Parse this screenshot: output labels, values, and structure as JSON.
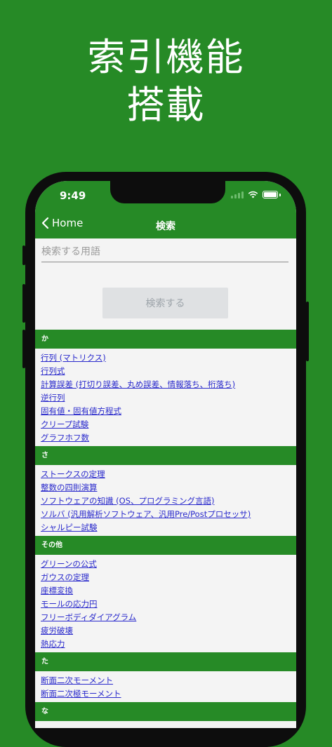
{
  "promo": {
    "line1": "索引機能",
    "line2": "搭載"
  },
  "status_bar": {
    "time": "9:49"
  },
  "nav": {
    "back_label": "Home",
    "title": "検索"
  },
  "search": {
    "placeholder": "検索する用語",
    "value": "",
    "button_label": "検索する"
  },
  "sections": [
    {
      "header": "か",
      "items": [
        "行列 (マトリクス)",
        "行列式",
        "計算誤差 (打切り誤差、丸め誤差、情報落ち、桁落ち)",
        "逆行列",
        "固有値・固有値方程式",
        " クリープ試験",
        "グラフホフ数"
      ]
    },
    {
      "header": "さ",
      "items": [
        "ストークスの定理",
        "整数の四則演算",
        "ソフトウェアの知識 (OS、プログラミング言語)",
        "ソルバ (汎用解析ソフトウェア、汎用Pre/Postプロセッサ)",
        "シャルピー試験"
      ]
    },
    {
      "header": "その他",
      "items": [
        "グリーンの公式",
        "ガウスの定理",
        "座標変換",
        "モールの応力円",
        "フリーボディダイアグラム",
        "疲労破壊",
        "熱応力"
      ]
    },
    {
      "header": "た",
      "items": [
        "断面二次モーメント",
        "断面二次極モーメント"
      ]
    },
    {
      "header": "な",
      "items": []
    }
  ],
  "colors": {
    "brand_green": "#268a26",
    "link_blue": "#2a2acc",
    "screen_bg": "#f4f4f4"
  }
}
